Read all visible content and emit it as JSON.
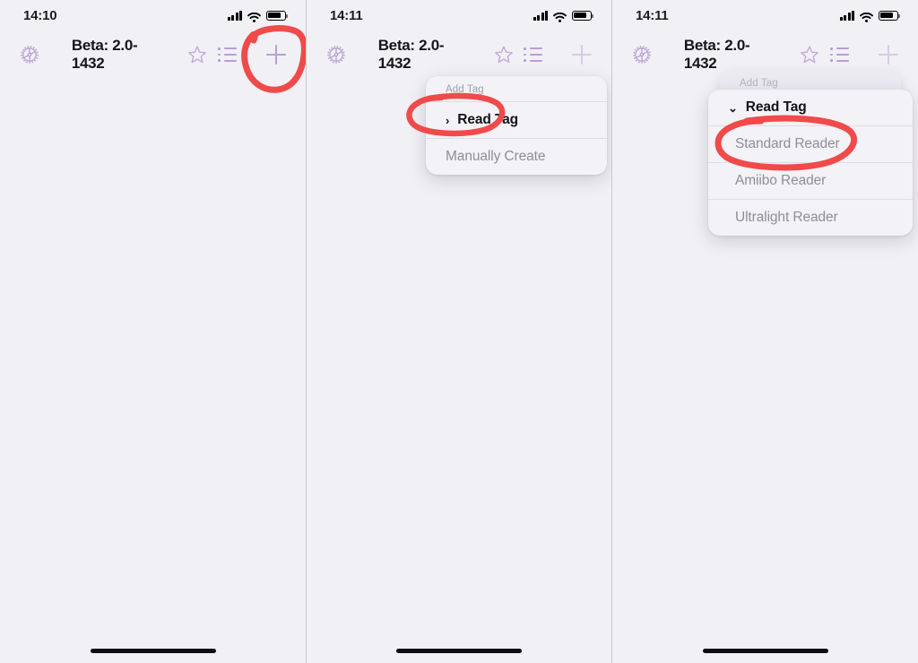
{
  "app": {
    "nav_title": "Beta: 2.0-1432"
  },
  "icons": {
    "settings": "gear-icon",
    "favorite": "star-icon",
    "list": "list-icon",
    "add": "plus-icon",
    "signal": "cellular-signal-icon",
    "wifi": "wifi-icon",
    "battery": "battery-icon",
    "chevron_right": "›",
    "chevron_down": "⌄"
  },
  "colors": {
    "accent_purple": "#b79fd4",
    "annotation_red": "#f04a4a",
    "screen_background": "#f1f0f5",
    "menu_background": "#f3f2f6",
    "title_text": "#15151a",
    "menu_item_text": "#8e8e96"
  },
  "panels": [
    {
      "id": "panel-1",
      "status_time": "14:10",
      "nav_title": "Beta: 2.0-1432",
      "add_button_dim": false,
      "menu": null,
      "annotation": "circle-around-plus-button"
    },
    {
      "id": "panel-2",
      "status_time": "14:11",
      "nav_title": "Beta: 2.0-1432",
      "add_button_dim": true,
      "menu": {
        "header": "Add Tag",
        "items": [
          {
            "label": "Read Tag",
            "active": true,
            "chevron": "›"
          },
          {
            "label": "Manually Create",
            "active": false,
            "chevron": ""
          }
        ]
      },
      "annotation": "circle-around-read-tag"
    },
    {
      "id": "panel-3",
      "status_time": "14:11",
      "nav_title": "Beta: 2.0-1432",
      "add_button_dim": true,
      "back_menu": {
        "header": "Add Tag"
      },
      "menu": {
        "header": null,
        "items": [
          {
            "label": "Read Tag",
            "active": true,
            "chevron": "⌄"
          },
          {
            "label": "Standard Reader",
            "active": false,
            "chevron": ""
          },
          {
            "label": "Amiibo Reader",
            "active": false,
            "chevron": ""
          },
          {
            "label": "Ultralight Reader",
            "active": false,
            "chevron": ""
          }
        ]
      },
      "annotation": "circle-around-standard-reader"
    }
  ]
}
